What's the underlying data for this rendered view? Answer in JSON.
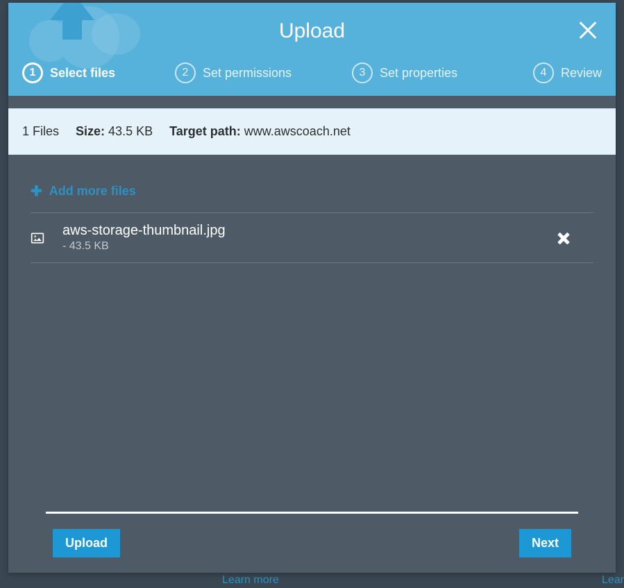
{
  "backdrop": {
    "learn_more": "Learn more",
    "learn_right": "Lear"
  },
  "modal": {
    "title": "Upload"
  },
  "steps": [
    {
      "num": "1",
      "label": "Select files",
      "active": true
    },
    {
      "num": "2",
      "label": "Set permissions",
      "active": false
    },
    {
      "num": "3",
      "label": "Set properties",
      "active": false
    },
    {
      "num": "4",
      "label": "Review",
      "active": false
    }
  ],
  "info": {
    "count_label": "1 Files",
    "size_label": "Size:",
    "size_value": "43.5 KB",
    "target_label": "Target path:",
    "target_value": "www.awscoach.net"
  },
  "add_more_label": "Add more files",
  "files": [
    {
      "name": "aws-storage-thumbnail.jpg",
      "size": "- 43.5 KB"
    }
  ],
  "buttons": {
    "upload": "Upload",
    "next": "Next"
  }
}
